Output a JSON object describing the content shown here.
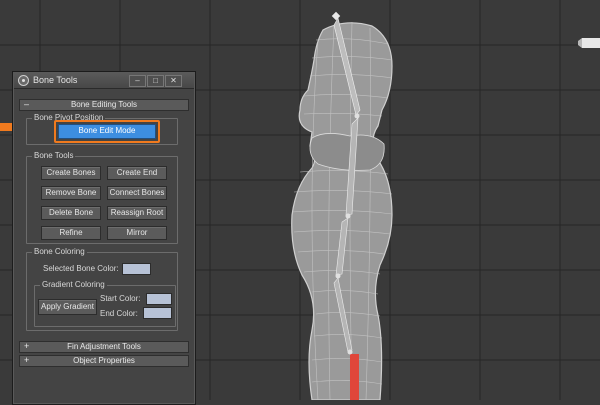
{
  "window": {
    "title": "Bone Tools",
    "minimize": "–",
    "maximize": "□",
    "close": "✕"
  },
  "rollouts": {
    "bone_editing": {
      "sign": "–",
      "label": "Bone Editing Tools"
    },
    "fin_adjustment": {
      "sign": "+",
      "label": "Fin Adjustment Tools"
    },
    "object_properties": {
      "sign": "+",
      "label": "Object Properties"
    }
  },
  "pivot_group": {
    "title": "Bone Pivot Position",
    "edit_mode_label": "Bone Edit Mode"
  },
  "bone_tools_group": {
    "title": "Bone Tools",
    "buttons": [
      "Create Bones",
      "Create End",
      "Remove Bone",
      "Connect Bones",
      "Delete Bone",
      "Reassign Root",
      "Refine",
      "Mirror"
    ]
  },
  "bone_coloring_group": {
    "title": "Bone Coloring",
    "selected_color_label": "Selected Bone Color:",
    "gradient": {
      "title": "Gradient Coloring",
      "apply_label": "Apply Gradient",
      "start_label": "Start Color:",
      "end_label": "End Color:"
    }
  },
  "colors": {
    "viewport_bg": "#3a3a3a",
    "highlight": "#f07a1e",
    "active_button": "#3d8ee0",
    "swatch": "#b7c2d6",
    "bone_selected": "#e0463a"
  },
  "icons": {
    "arrow": "orange-arrow-icon",
    "app": "3dsmax-logo-icon",
    "nav": "viewcube-icon"
  }
}
